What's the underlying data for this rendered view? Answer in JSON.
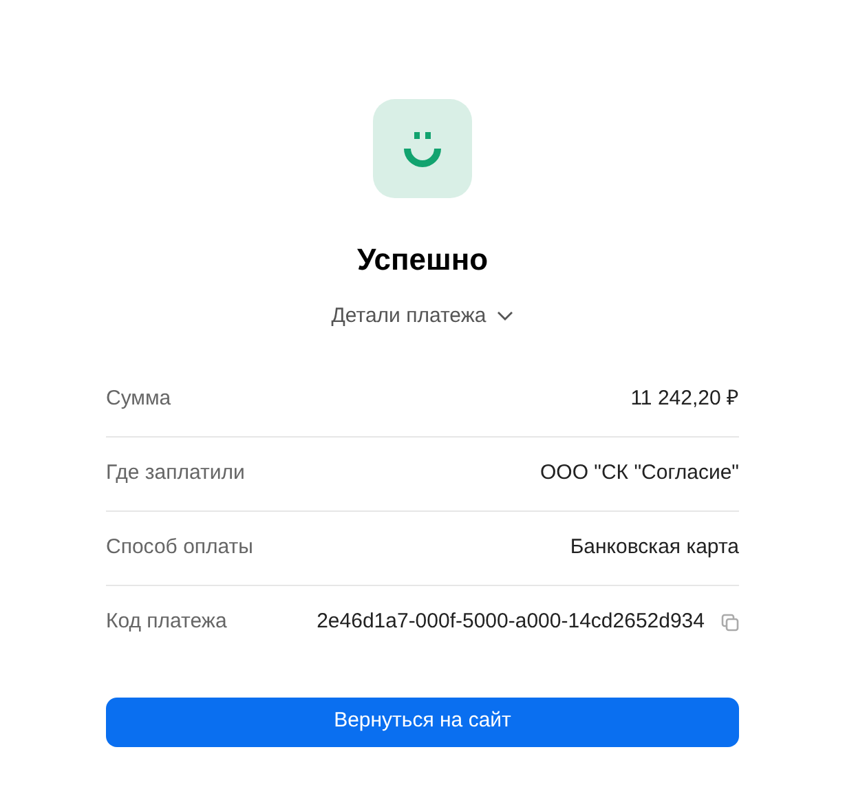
{
  "title": "Успешно",
  "details_toggle": {
    "label": "Детали платежа",
    "expanded": false
  },
  "rows": [
    {
      "label": "Сумма",
      "value": "11 242,20 ₽",
      "copyable": false
    },
    {
      "label": "Где заплатили",
      "value": "ООО \"СК \"Согласие\"",
      "copyable": false
    },
    {
      "label": "Способ оплаты",
      "value": "Банковская карта",
      "copyable": false
    },
    {
      "label": "Код платежа",
      "value": "2e46d1a7-000f-5000-a000-14cd2652d934",
      "copyable": true
    }
  ],
  "button": "Вернуться на сайт"
}
